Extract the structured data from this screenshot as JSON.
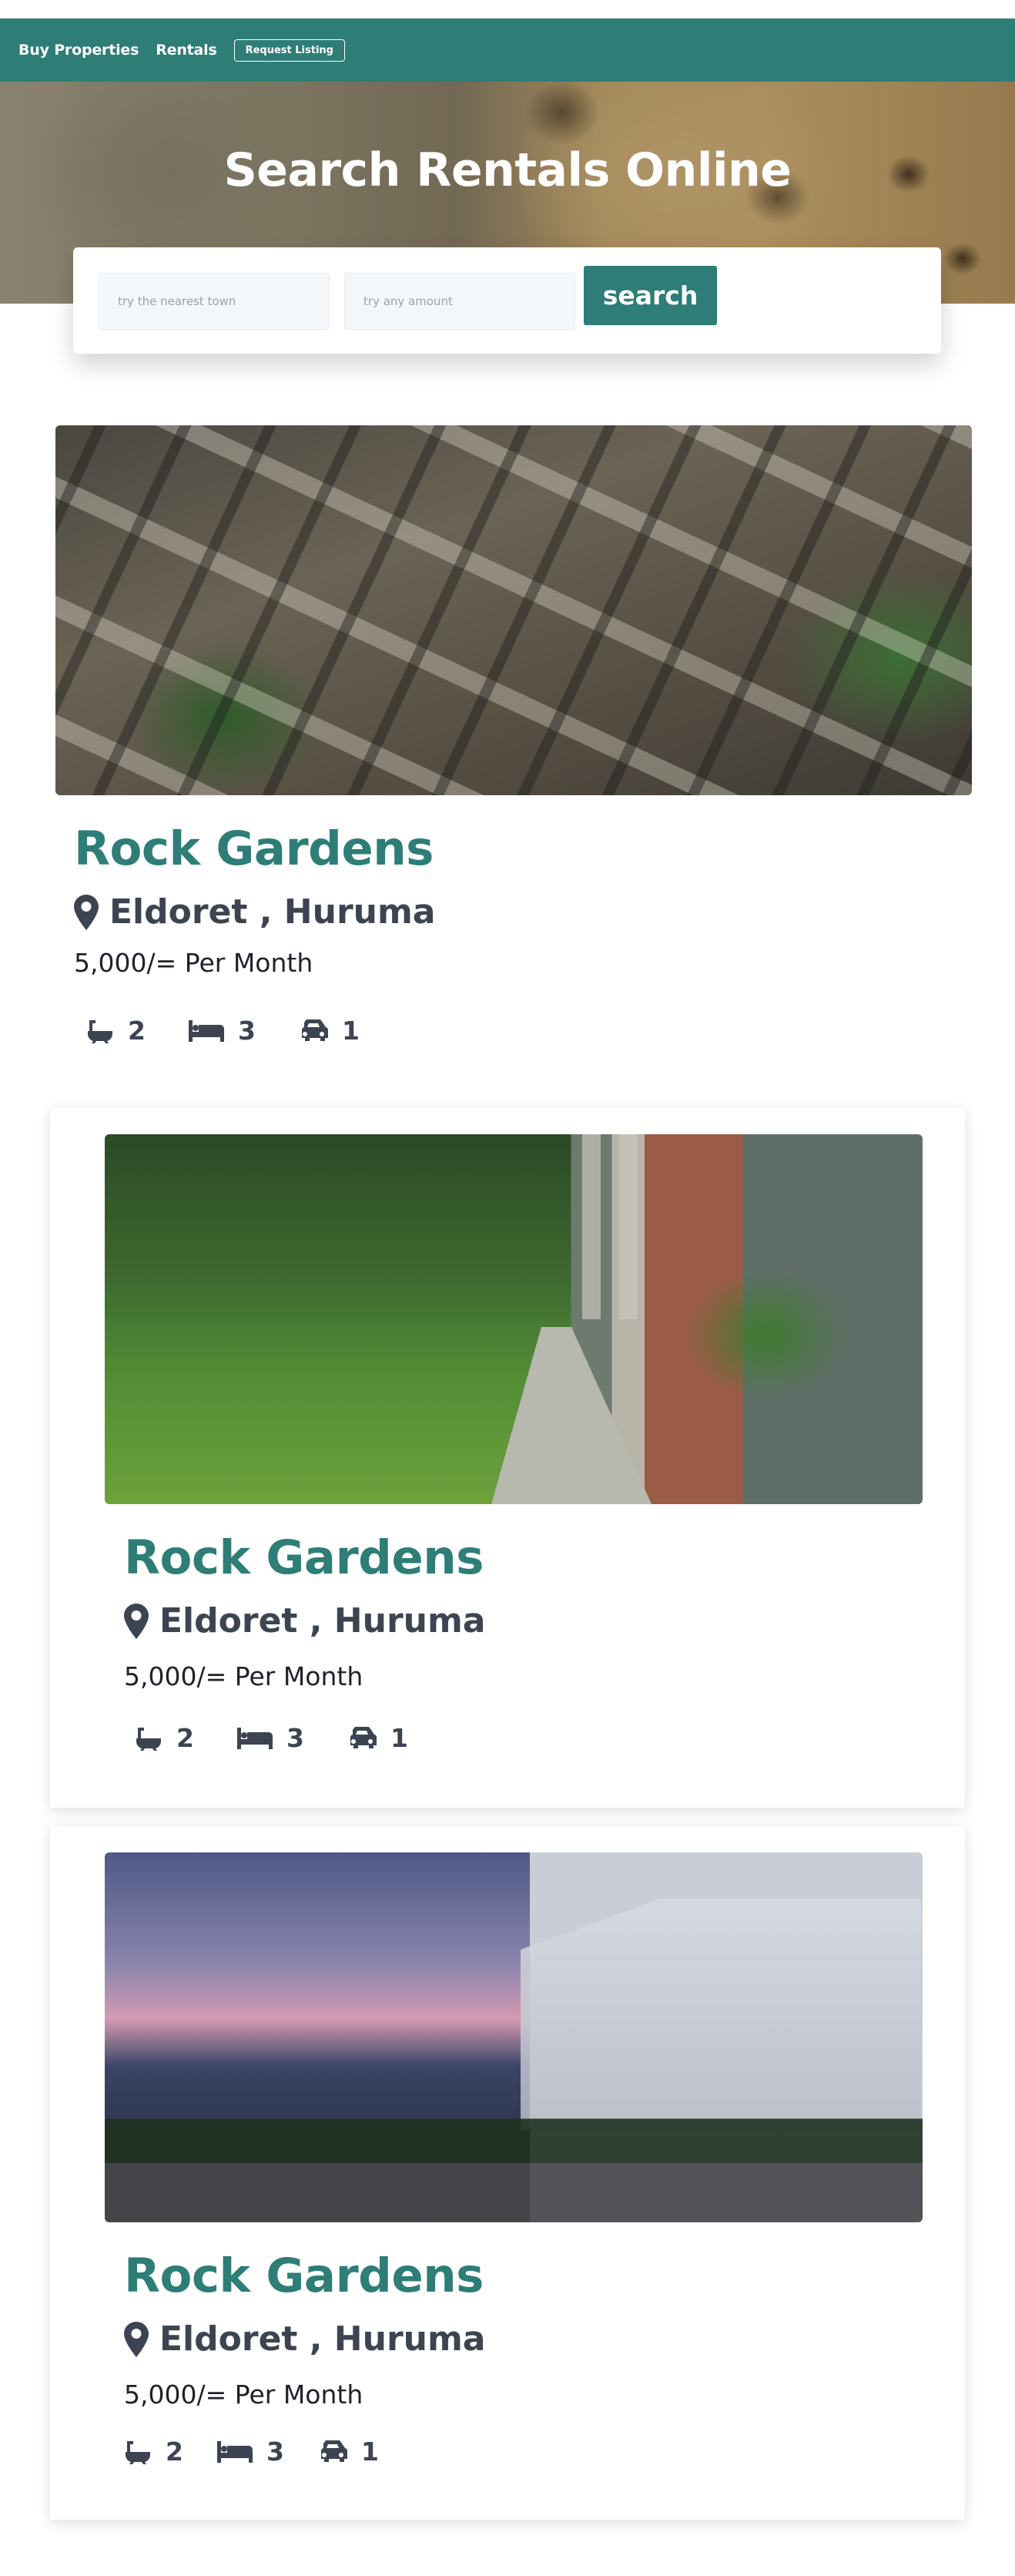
{
  "nav": {
    "buy_properties": "Buy Properties",
    "rentals": "Rentals",
    "request_listing": "Request Listing"
  },
  "hero": {
    "title": "Search Rentals Online"
  },
  "search": {
    "town_placeholder": "try the nearest town",
    "amount_placeholder": "try any amount",
    "button_label": "search"
  },
  "colors": {
    "brand": "#2e7d77",
    "text": "#3d4451"
  },
  "listings": [
    {
      "title": "Rock Gardens",
      "location": "Eldoret , Huruma",
      "price": "5,000/= Per Month",
      "baths": "2",
      "beds": "3",
      "parking": "1",
      "image": "aerial-houses"
    },
    {
      "title": "Rock Gardens",
      "location": "Eldoret , Huruma",
      "price": "5,000/= Per Month",
      "baths": "2",
      "beds": "3",
      "parking": "1",
      "image": "garden-path"
    },
    {
      "title": "Rock Gardens",
      "location": "Eldoret , Huruma",
      "price": "5,000/= Per Month",
      "baths": "2",
      "beds": "3",
      "parking": "1",
      "image": "street-dusk"
    }
  ],
  "icons": [
    "map-marker-icon",
    "bath-icon",
    "bed-icon",
    "car-icon"
  ]
}
